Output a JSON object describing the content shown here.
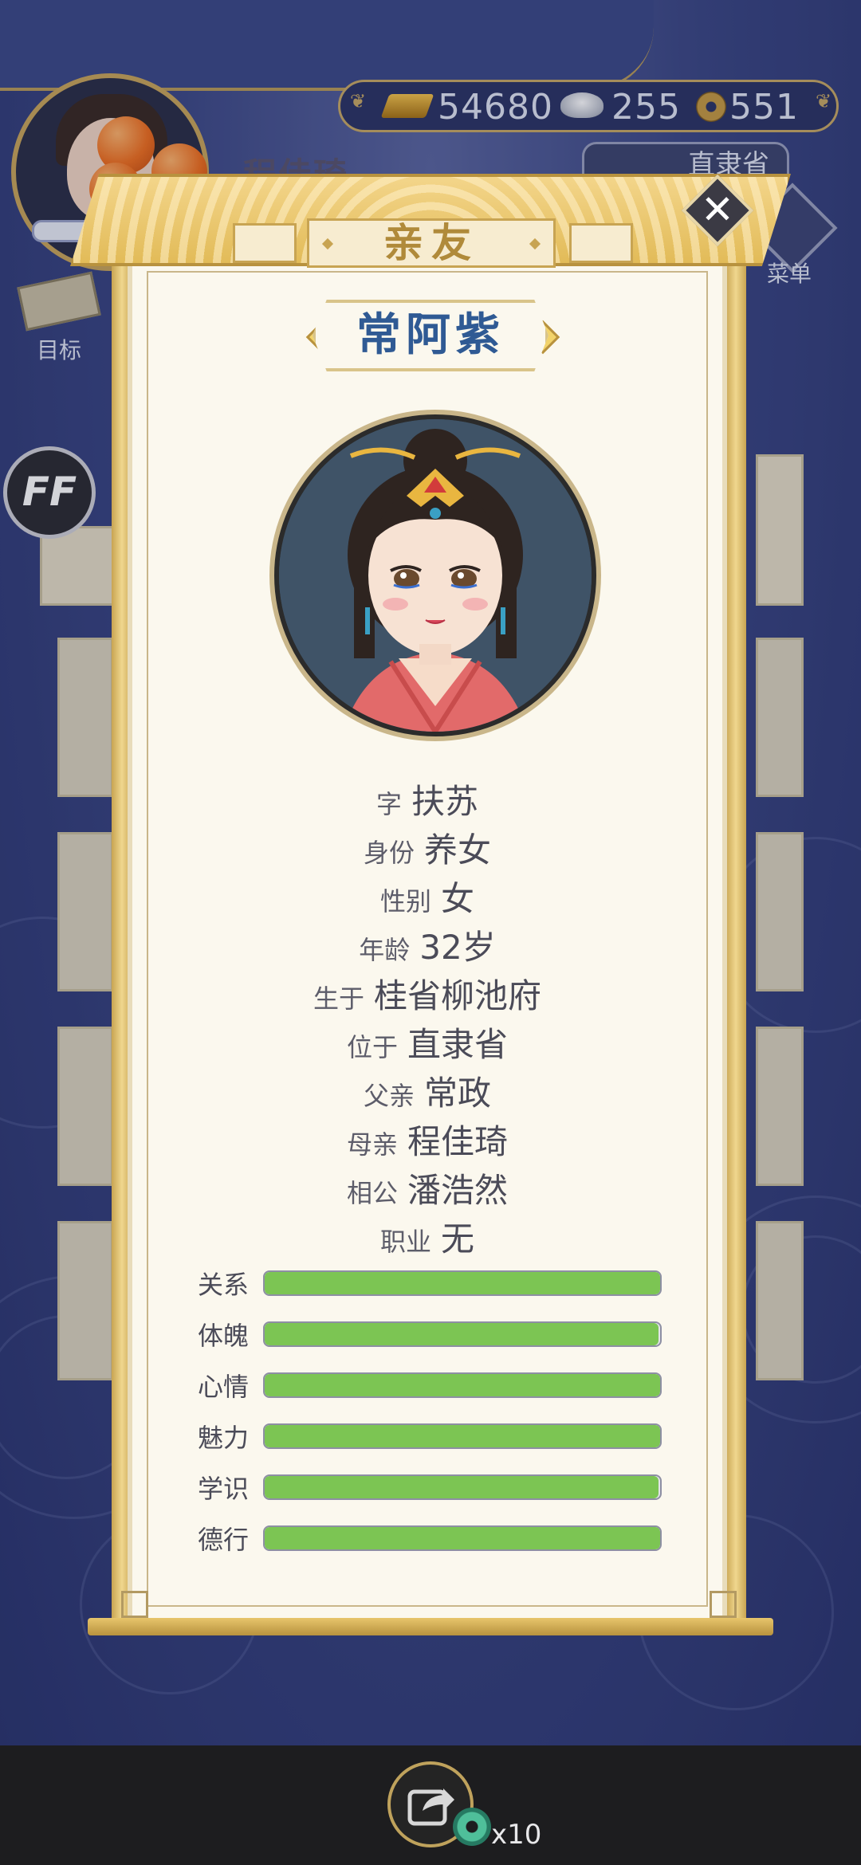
{
  "player": {
    "name": "程佳琦",
    "province": "直隶省"
  },
  "currency": {
    "gold": "54680",
    "silver": "255",
    "coins": "551"
  },
  "sidebar": {
    "menu_label": "菜单",
    "goal_label": "目标",
    "ff_label": "FF"
  },
  "panel": {
    "title": "亲友",
    "name": "常阿紫",
    "info": [
      {
        "label": "字",
        "value": "扶苏"
      },
      {
        "label": "身份",
        "value": "养女"
      },
      {
        "label": "性别",
        "value": "女"
      },
      {
        "label": "年龄",
        "value": "32岁"
      },
      {
        "label": "生于",
        "value": "桂省柳池府"
      },
      {
        "label": "位于",
        "value": "直隶省"
      },
      {
        "label": "父亲",
        "value": "常政"
      },
      {
        "label": "母亲",
        "value": "程佳琦"
      },
      {
        "label": "相公",
        "value": "潘浩然"
      },
      {
        "label": "职业",
        "value": "无"
      }
    ],
    "stats": [
      {
        "label": "关系",
        "fill": 1.0
      },
      {
        "label": "体魄",
        "fill": 0.995
      },
      {
        "label": "心情",
        "fill": 1.0
      },
      {
        "label": "魅力",
        "fill": 1.0
      },
      {
        "label": "学识",
        "fill": 0.995
      },
      {
        "label": "德行",
        "fill": 1.0
      }
    ]
  },
  "bottom": {
    "reward_count": "x10"
  },
  "colors": {
    "stat_fill": "#7cc553",
    "name_blue": "#2f5a94",
    "gold_trim": "#c8a452",
    "paper": "#fbf8ee"
  },
  "icons": {
    "gold": "gold-ingot-icon",
    "silver": "silver-ingot-icon",
    "coin": "copper-coin-icon",
    "close": "close-icon",
    "menu": "menu-icon",
    "goal": "goal-scroll-icon",
    "share": "share-icon",
    "jade": "jade-coin-icon"
  }
}
